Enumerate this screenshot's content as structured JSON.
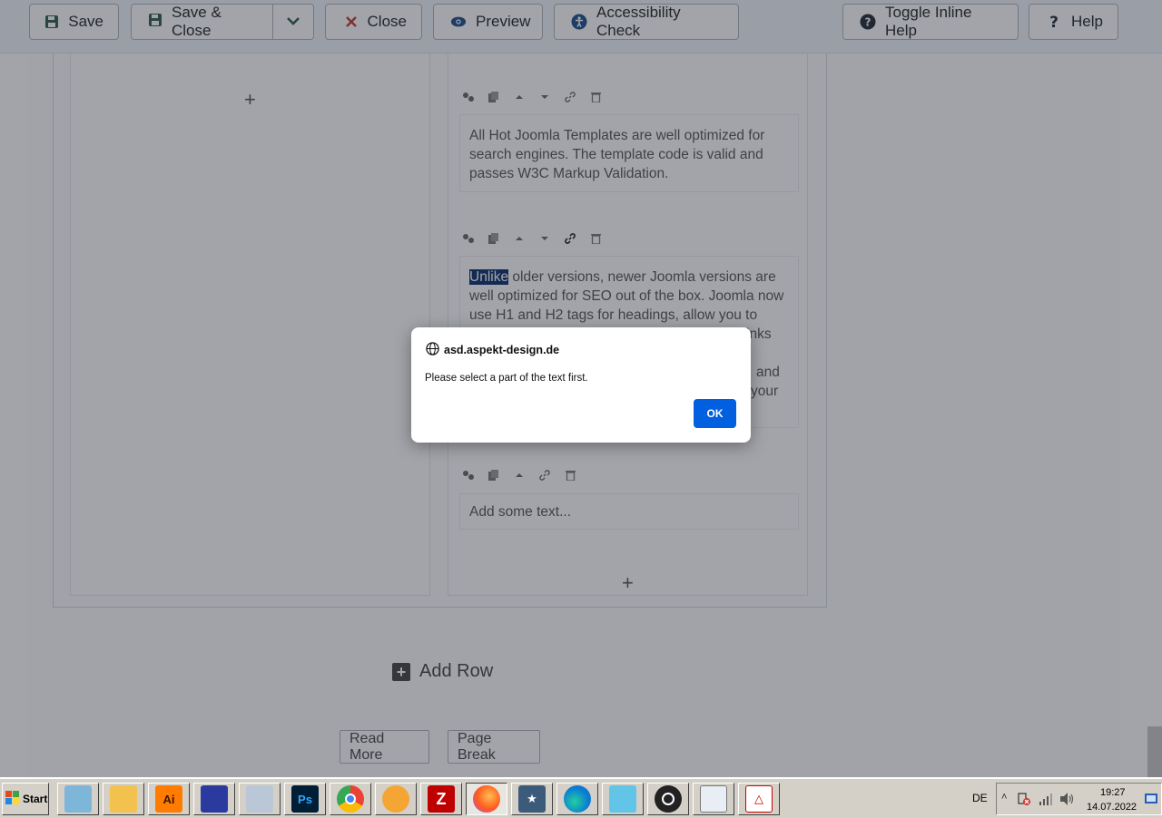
{
  "toolbar": {
    "save": "Save",
    "save_close": "Save & Close",
    "close": "Close",
    "preview": "Preview",
    "accessibility": "Accessibility Check",
    "toggle_help": "Toggle Inline Help",
    "help": "Help"
  },
  "editor": {
    "block1": "All Hot Joomla Templates are well optimized for search engines. The template code is valid and passes W3C Markup Validation.",
    "block2_selected": "Unlike",
    "block2_rest": " older versions, newer Joomla versions are well optimized for SEO out of the box. Joomla now use H1 and H2 tags for headings, allow you to",
    "block2_line4_end": "inks",
    "block2_line6_end": "and",
    "block2_line7_end": "your",
    "block3_placeholder": "Add some text...",
    "add_row": "Add Row",
    "read_more": "Read More",
    "page_break": "Page Break"
  },
  "dialog": {
    "origin": "asd.aspekt-design.de",
    "message": "Please select a part of the text first.",
    "ok": "OK"
  },
  "taskbar": {
    "start": "Start",
    "lang": "DE",
    "time": "19:27",
    "date": "14.07.2022"
  },
  "colors": {
    "accent": "#0060df",
    "selection": "#0a2d6b"
  }
}
